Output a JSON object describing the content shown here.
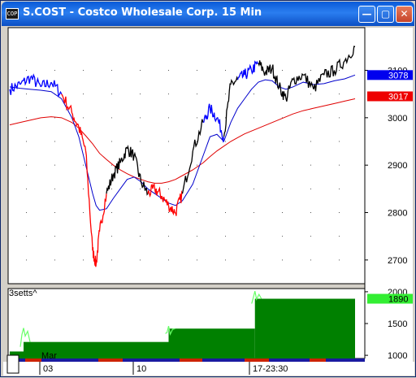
{
  "window": {
    "title": "S.COST - Costco Wholesale Corp. 15 Min",
    "icon_text": "COP",
    "buttons": [
      "minimize",
      "maximize",
      "close"
    ]
  },
  "colors": {
    "price_up_leg": "#0000ff",
    "price_down_leg": "#ff0000",
    "price_neutral": "#000000",
    "ma_short": "#0000cc",
    "ma_long": "#e00000",
    "indicator_fill": "#008000",
    "indicator_spike": "#66ff66"
  },
  "chart_data": [
    {
      "type": "line",
      "title": "S.COST - Costco Wholesale Corp. 15 Min",
      "x_tick_labels": [
        "03",
        "10",
        "17-23:30"
      ],
      "x_month_label": "Mar",
      "y_tick_labels": [
        "3100",
        "3000",
        "2900",
        "2800",
        "2700"
      ],
      "ylim": [
        2650,
        3190
      ],
      "grid": "dotted",
      "x": [
        0,
        3,
        6,
        9,
        12,
        15,
        18,
        20,
        22,
        24,
        25,
        26,
        28,
        30,
        32,
        34,
        36,
        38,
        40,
        42,
        44,
        46,
        48,
        50,
        53,
        56,
        58,
        60,
        62,
        64,
        66,
        68,
        70,
        72,
        74,
        76,
        78,
        80,
        82,
        85,
        88,
        91,
        94,
        97,
        100
      ],
      "series": [
        {
          "role": "price",
          "values": [
            3060,
            3070,
            3085,
            3065,
            3075,
            3050,
            3010,
            2980,
            2930,
            2720,
            2690,
            2760,
            2840,
            2880,
            2905,
            2935,
            2920,
            2865,
            2840,
            2850,
            2835,
            2815,
            2800,
            2840,
            2930,
            2990,
            3020,
            3000,
            2960,
            3070,
            3080,
            3090,
            3100,
            3115,
            3095,
            3105,
            3065,
            3040,
            3080,
            3090,
            3060,
            3090,
            3100,
            3120,
            3150
          ],
          "segment_colors": [
            {
              "from": 0,
              "to": 15,
              "color": "blue"
            },
            {
              "from": 15,
              "to": 24,
              "color": "red"
            },
            {
              "from": 24,
              "to": 28,
              "color": "red"
            },
            {
              "from": 40,
              "to": 50,
              "color": "red"
            },
            {
              "from": 56,
              "to": 62,
              "color": "blue"
            },
            {
              "from": 66,
              "to": 72,
              "color": "blue"
            }
          ]
        },
        {
          "role": "ma_short",
          "values": [
            3065,
            3062,
            3060,
            3058,
            3055,
            3040,
            3000,
            2960,
            2900,
            2840,
            2815,
            2805,
            2808,
            2830,
            2850,
            2870,
            2875,
            2865,
            2850,
            2840,
            2830,
            2820,
            2815,
            2825,
            2860,
            2920,
            2960,
            2965,
            2950,
            2990,
            3020,
            3040,
            3060,
            3075,
            3080,
            3078,
            3065,
            3060,
            3065,
            3075,
            3070,
            3072,
            3078,
            3082,
            3090
          ]
        },
        {
          "role": "ma_long",
          "values": [
            2985,
            2990,
            2995,
            3000,
            3002,
            3000,
            2990,
            2978,
            2962,
            2945,
            2935,
            2925,
            2912,
            2900,
            2890,
            2882,
            2875,
            2870,
            2865,
            2862,
            2862,
            2865,
            2870,
            2878,
            2890,
            2905,
            2918,
            2930,
            2940,
            2950,
            2958,
            2966,
            2972,
            2978,
            2984,
            2990,
            2996,
            3002,
            3008,
            3015,
            3020,
            3025,
            3030,
            3035,
            3040
          ]
        }
      ],
      "right_value_badges": [
        {
          "label": "3078",
          "color": "blue"
        },
        {
          "label": "3017",
          "color": "red"
        }
      ]
    },
    {
      "type": "area",
      "title": "3setts^",
      "y_tick_labels": [
        "2000",
        "1500",
        "1000"
      ],
      "ylim": [
        950,
        2050
      ],
      "steps": [
        {
          "x0": 0,
          "x1": 4,
          "value": 1060
        },
        {
          "x0": 4,
          "x1": 46,
          "value": 1210
        },
        {
          "x0": 46,
          "x1": 71,
          "value": 1420
        },
        {
          "x0": 71,
          "x1": 100,
          "value": 1890
        }
      ],
      "spikes": [
        {
          "x": 4,
          "value": 1430
        },
        {
          "x": 46,
          "value": 1460
        },
        {
          "x": 71,
          "value": 2010
        }
      ],
      "badge": {
        "label": "1890",
        "color": "green"
      }
    }
  ]
}
